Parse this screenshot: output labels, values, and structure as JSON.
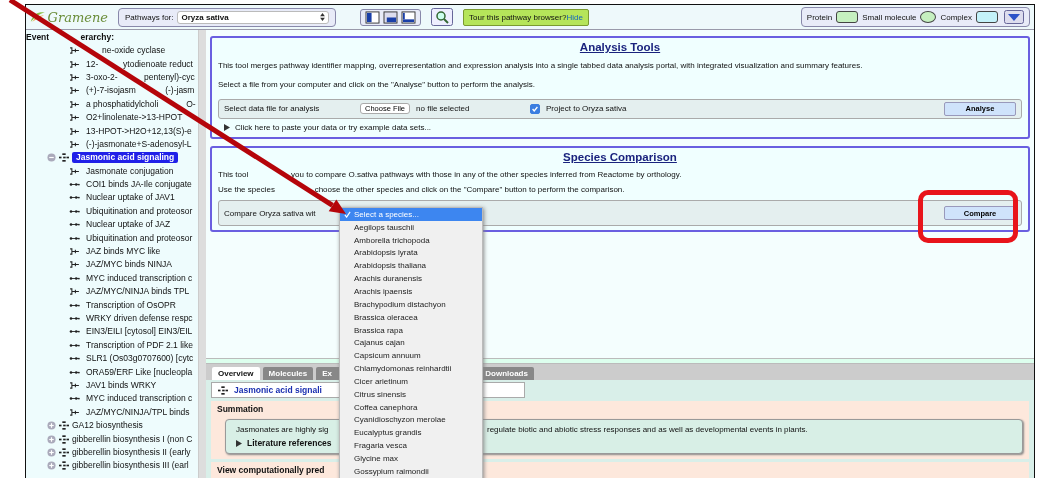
{
  "header": {
    "logo": "Gramene",
    "species_label": "Pathways for:",
    "species_value": "Oryza sativa",
    "tour_text": "Tour this pathway browser?",
    "tour_link": "Hide",
    "legend": [
      {
        "label": "Protein",
        "kind": "protein"
      },
      {
        "label": "Small molecule",
        "kind": "molecule"
      },
      {
        "label": "Complex",
        "kind": "complex"
      }
    ]
  },
  "sidebar": {
    "title": "Event",
    "title_after": "erarchy:",
    "orphan_events": [
      {
        "label_after": "ne-oxide cyclase",
        "kind": "reaction"
      },
      {
        "label": "12-",
        "label_after": "ytodienoate reduct",
        "kind": "reaction"
      },
      {
        "label": "3-oxo-2-",
        "label_after": "pentenyl)-cyc",
        "kind": "reaction"
      },
      {
        "label": "(+)-7-isojasm",
        "label_after": "(-)-jasm",
        "kind": "reaction"
      },
      {
        "label": "a phosphatidylcholi",
        "label_after": "O-",
        "kind": "reaction"
      },
      {
        "label": "O2+linolenate->13-HPOT",
        "kind": "reaction"
      },
      {
        "label": "13-HPOT->H2O+12,13(S)-e",
        "kind": "reaction"
      },
      {
        "label": "(-)-jasmonate+S-adenosyl-L",
        "kind": "reaction"
      }
    ],
    "pathways": [
      {
        "label": "Jasmonic acid signaling",
        "expanded": true,
        "selected": true,
        "children": [
          {
            "label": "Jasmonate conjugation",
            "kind": "reaction"
          },
          {
            "label": "COI1 binds JA-Ile conjugate",
            "kind": "blackbox"
          },
          {
            "label": "Nuclear uptake of JAV1",
            "kind": "blackbox"
          },
          {
            "label": "Ubiquitination and proteosor",
            "kind": "blackbox"
          },
          {
            "label": "Nuclear uptake of JAZ",
            "kind": "blackbox"
          },
          {
            "label": "Ubiquitination and proteosor",
            "kind": "blackbox"
          },
          {
            "label": "JAZ binds MYC like",
            "kind": "reaction"
          },
          {
            "label": "JAZ/MYC binds NINJA",
            "kind": "reaction"
          },
          {
            "label": "MYC induced transcription c",
            "kind": "blackbox"
          },
          {
            "label": "JAZ/MYC/NINJA binds TPL",
            "kind": "reaction"
          },
          {
            "label": "Transcription of OsOPR",
            "kind": "blackbox"
          },
          {
            "label": "WRKY driven defense respc",
            "kind": "blackbox"
          },
          {
            "label": "EIN3/EILI [cytosol] EIN3/EIL",
            "kind": "blackbox"
          },
          {
            "label": "Transcription of PDF 2.1 like",
            "kind": "blackbox"
          },
          {
            "label": "SLR1 (Os03g0707600) [cytc",
            "kind": "blackbox"
          },
          {
            "label": "ORA59/ERF Like [nucleopla",
            "kind": "blackbox"
          },
          {
            "label": "JAV1 binds WRKY",
            "kind": "reaction"
          },
          {
            "label": "MYC induced transcription c",
            "kind": "blackbox"
          },
          {
            "label": "JAZ/MYC/NINJA/TPL binds",
            "kind": "reaction"
          }
        ]
      },
      {
        "label": "GA12 biosynthesis",
        "expanded": false,
        "selected": false
      },
      {
        "label": "gibberellin biosynthesis I (non C",
        "expanded": false,
        "selected": false
      },
      {
        "label": "gibberellin biosynthesis II (early",
        "expanded": false,
        "selected": false
      },
      {
        "label": "gibberellin biosynthesis III (earl",
        "expanded": false,
        "selected": false
      }
    ]
  },
  "analysis": {
    "title": "Analysis Tools",
    "description": "This tool merges pathway identifier mapping, overrepresentation and expression analysis into a single tabbed data analysis portal, with integrated visualization and summary features.",
    "instruction": "Select a file from your computer and click on the \"Analyse\" button to perform the analysis.",
    "file_label": "Select data file for analysis",
    "choose_button": "Choose File",
    "file_status": "no file selected",
    "project_label": "Project to Oryza sativa",
    "project_checked": true,
    "analyse_button": "Analyse",
    "paste_toggle": "Click here to paste your data or try example data sets..."
  },
  "species": {
    "title": "Species Comparison",
    "description": "This tool",
    "description_after": "you to compare O.sativa pathways with those in any of the other species inferred from Reactome by orthology.",
    "instruction": "Use the species",
    "instruction_after": "choose the other species and click on the \"Compare\" button to perform the comparison.",
    "compare_label": "Compare Oryza sativa wit",
    "compare_button": "Compare"
  },
  "species_dropdown": [
    {
      "label": "Select a species...",
      "selected": true
    },
    {
      "label": "Aegilops tauschii",
      "selected": false
    },
    {
      "label": "Amborella trichopoda",
      "selected": false
    },
    {
      "label": "Arabidopsis lyrata",
      "selected": false
    },
    {
      "label": "Arabidopsis thaliana",
      "selected": false
    },
    {
      "label": "Arachis duranensis",
      "selected": false
    },
    {
      "label": "Arachis ipaensis",
      "selected": false
    },
    {
      "label": "Brachypodium distachyon",
      "selected": false
    },
    {
      "label": "Brassica oleracea",
      "selected": false
    },
    {
      "label": "Brassica rapa",
      "selected": false
    },
    {
      "label": "Cajanus cajan",
      "selected": false
    },
    {
      "label": "Capsicum annuum",
      "selected": false
    },
    {
      "label": "Chlamydomonas reinhardtii",
      "selected": false
    },
    {
      "label": "Cicer arietinum",
      "selected": false
    },
    {
      "label": "Citrus sinensis",
      "selected": false
    },
    {
      "label": "Coffea canephora",
      "selected": false
    },
    {
      "label": "Cyanidioschyzon merolae",
      "selected": false
    },
    {
      "label": "Eucalyptus grandis",
      "selected": false
    },
    {
      "label": "Fragaria vesca",
      "selected": false
    },
    {
      "label": "Glycine max",
      "selected": false
    },
    {
      "label": "Gossypium raimondii",
      "selected": false
    }
  ],
  "details": {
    "tabs": [
      {
        "label": "Overview",
        "selected": true
      },
      {
        "label": "Molecules",
        "selected": false
      },
      {
        "label": "Ex",
        "selected": false
      },
      {
        "label": "Downloads",
        "selected": false
      }
    ],
    "pathway_title": "Jasmonic acid signali",
    "summation_title": "Summation",
    "summation_text_start": "Jasmonates are highly sig",
    "summation_text_end": "regulate biotic and abiotic stress responses and as well as developmental events in plants.",
    "literature": "Literature references",
    "view_predicted": "View computationally pred"
  }
}
